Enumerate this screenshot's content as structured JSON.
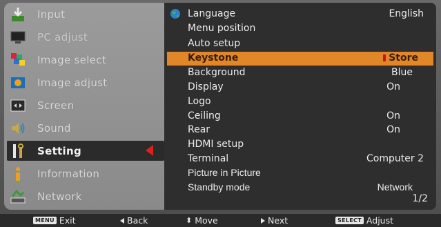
{
  "left_menu": {
    "items": [
      {
        "label": "Input",
        "icon": "input-icon"
      },
      {
        "label": "PC adjust",
        "icon": "pc-adjust-icon"
      },
      {
        "label": "Image select",
        "icon": "image-select-icon"
      },
      {
        "label": "Image adjust",
        "icon": "image-adjust-icon"
      },
      {
        "label": "Screen",
        "icon": "screen-icon"
      },
      {
        "label": "Sound",
        "icon": "sound-icon"
      },
      {
        "label": "Setting",
        "icon": "setting-icon"
      },
      {
        "label": "Information",
        "icon": "information-icon"
      },
      {
        "label": "Network",
        "icon": "network-icon"
      }
    ],
    "active_index": 6
  },
  "settings": {
    "rows": [
      {
        "name": "Language",
        "value": "English"
      },
      {
        "name": "Menu position",
        "value": ""
      },
      {
        "name": "Auto setup",
        "value": ""
      },
      {
        "name": "Keystone",
        "value": "Store"
      },
      {
        "name": "Background",
        "value": "Blue"
      },
      {
        "name": "Display",
        "value": "On"
      },
      {
        "name": "Logo",
        "value": ""
      },
      {
        "name": "Ceiling",
        "value": "On"
      },
      {
        "name": "Rear",
        "value": "On"
      },
      {
        "name": "HDMI setup",
        "value": ""
      },
      {
        "name": "Terminal",
        "value": "Computer 2"
      },
      {
        "name": "Picture in Picture",
        "value": ""
      },
      {
        "name": "Standby mode",
        "value": "Network"
      }
    ],
    "highlight_index": 3,
    "page": "1/2"
  },
  "footer": {
    "exit_key": "MENU",
    "exit_label": "Exit",
    "back_label": "Back",
    "move_label": "Move",
    "next_label": "Next",
    "adjust_key": "SELECT",
    "adjust_label": "Adjust"
  },
  "colors": {
    "highlight": "#e0872a",
    "arrow": "#e0201b"
  }
}
